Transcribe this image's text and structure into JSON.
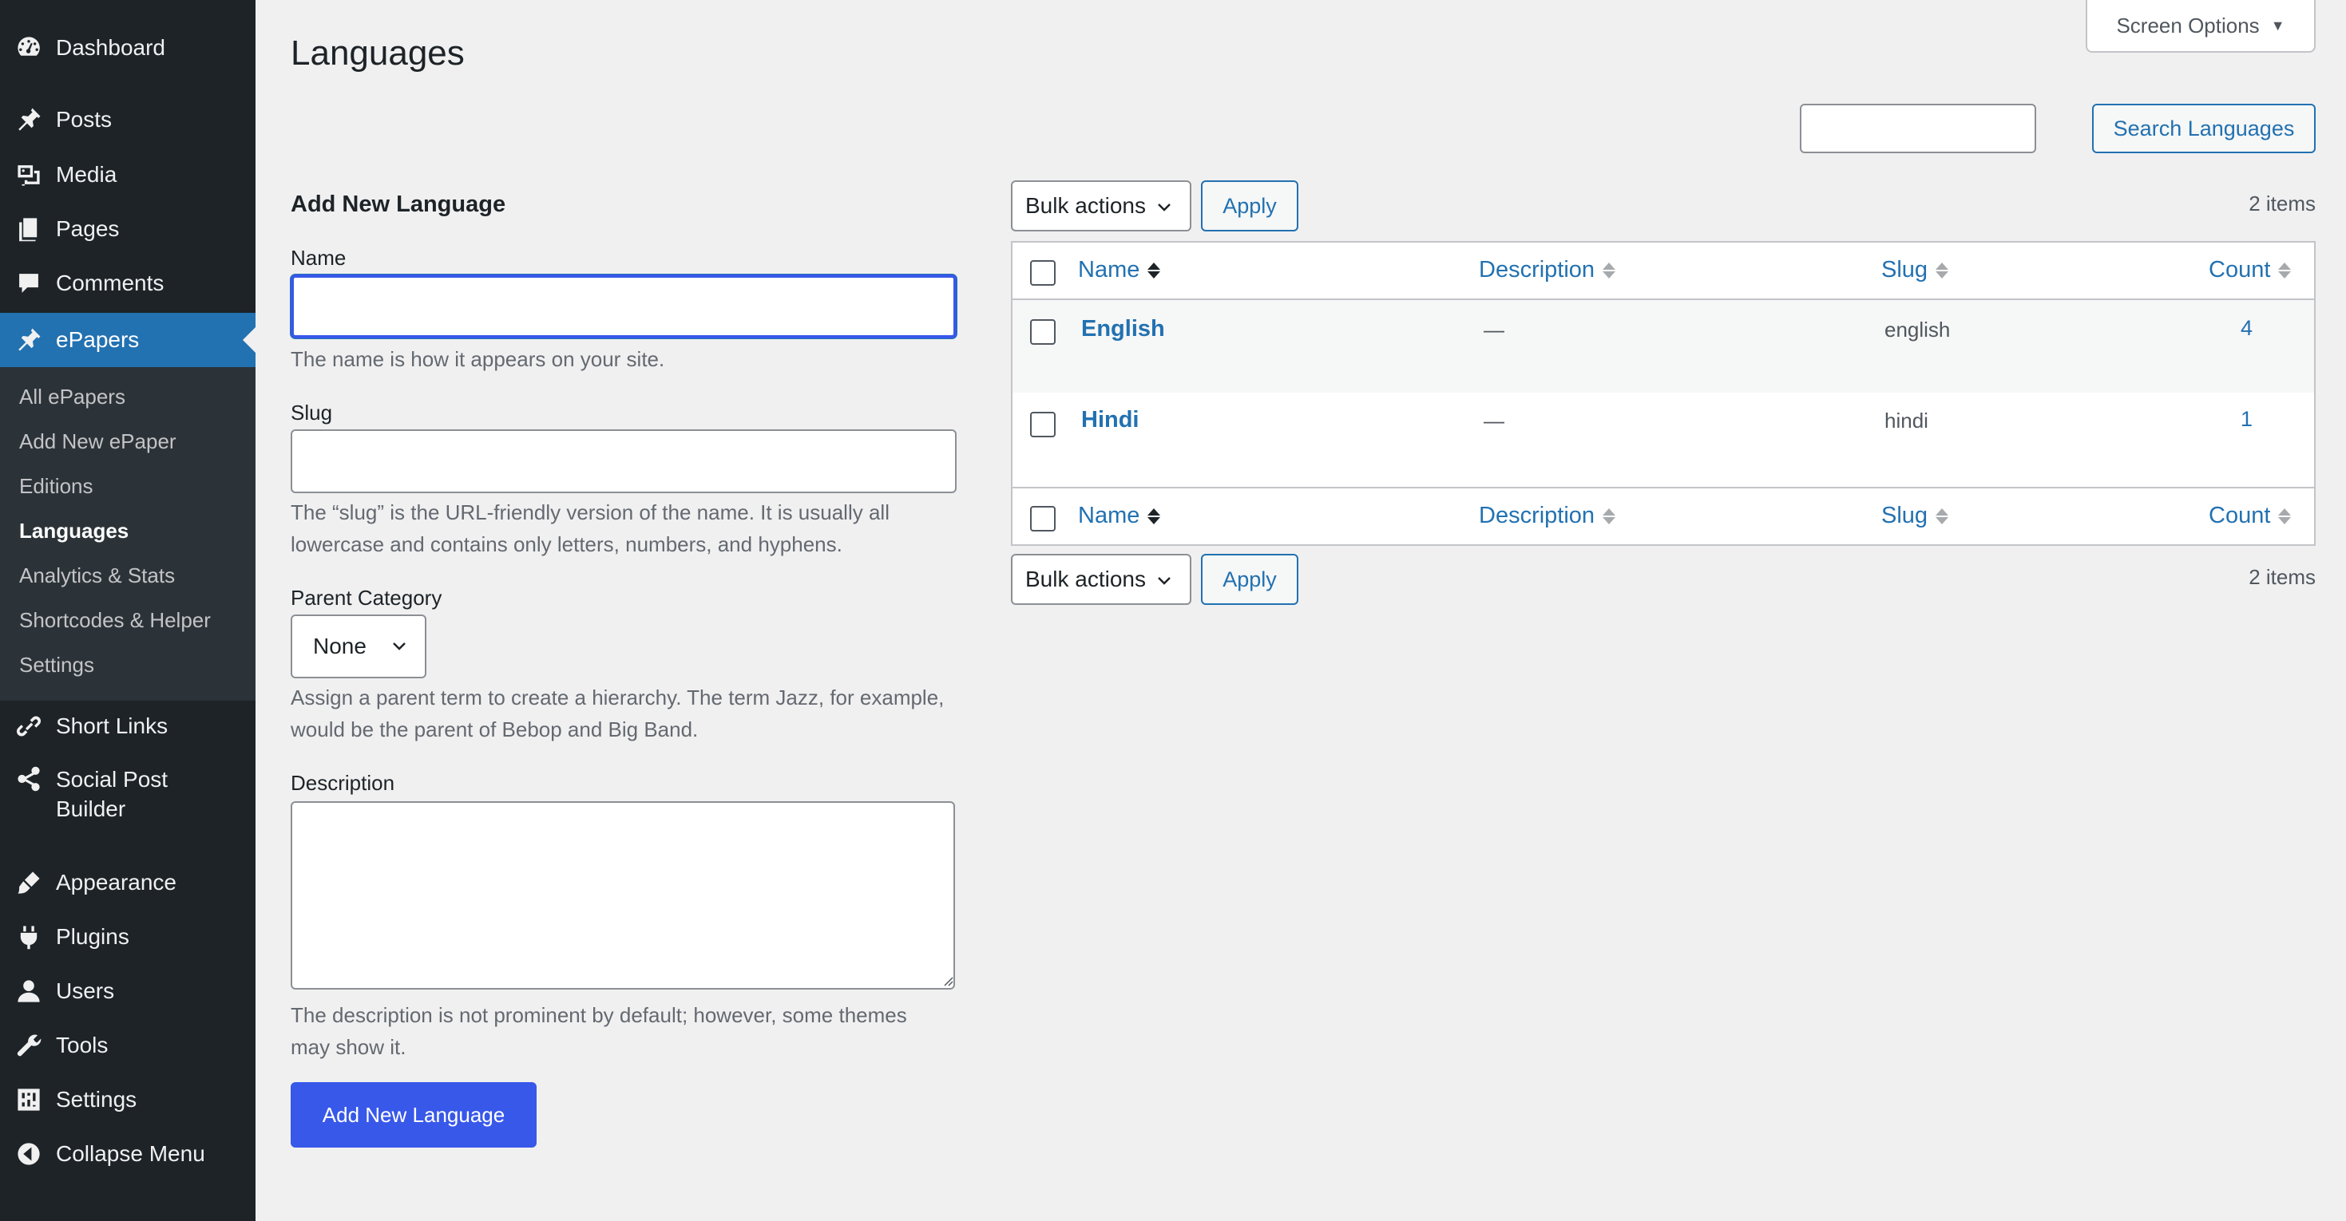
{
  "sidebar": {
    "menu": [
      {
        "label": "Dashboard",
        "icon": "dashboard-icon"
      },
      {
        "label": "Posts",
        "icon": "pin-icon"
      },
      {
        "label": "Media",
        "icon": "media-icon"
      },
      {
        "label": "Pages",
        "icon": "pages-icon"
      },
      {
        "label": "Comments",
        "icon": "comment-icon"
      },
      {
        "label": "ePapers",
        "icon": "pin-icon"
      },
      {
        "label": "Short Links",
        "icon": "link-icon"
      },
      {
        "label": "Social Post Builder",
        "icon": "share-icon"
      },
      {
        "label": "Appearance",
        "icon": "brush-icon"
      },
      {
        "label": "Plugins",
        "icon": "plugin-icon"
      },
      {
        "label": "Users",
        "icon": "user-icon"
      },
      {
        "label": "Tools",
        "icon": "wrench-icon"
      },
      {
        "label": "Settings",
        "icon": "settings-icon"
      },
      {
        "label": "Collapse Menu",
        "icon": "collapse-icon"
      }
    ],
    "submenu": [
      {
        "label": "All ePapers"
      },
      {
        "label": "Add New ePaper"
      },
      {
        "label": "Editions"
      },
      {
        "label": "Languages"
      },
      {
        "label": "Analytics & Stats"
      },
      {
        "label": "Shortcodes & Helper"
      },
      {
        "label": "Settings"
      }
    ]
  },
  "header": {
    "title": "Languages",
    "screen_options": "Screen Options",
    "search_value": "",
    "search_button": "Search Languages"
  },
  "form": {
    "heading": "Add New Language",
    "name_label": "Name",
    "name_value": "",
    "name_help": "The name is how it appears on your site.",
    "slug_label": "Slug",
    "slug_value": "",
    "slug_help": "The “slug” is the URL-friendly version of the name. It is usually all lowercase and contains only letters, numbers, and hyphens.",
    "parent_label": "Parent Category",
    "parent_value": "None",
    "parent_help": "Assign a parent term to create a hierarchy. The term Jazz, for example, would be the parent of Bebop and Big Band.",
    "description_label": "Description",
    "description_help": "The description is not prominent by default; however, some themes may show it.",
    "submit_label": "Add New Language"
  },
  "table": {
    "bulk_actions": "Bulk actions",
    "apply": "Apply",
    "items_count": "2 items",
    "columns": {
      "name": "Name",
      "description": "Description",
      "slug": "Slug",
      "count": "Count"
    },
    "rows": [
      {
        "name": "English",
        "description": "—",
        "slug": "english",
        "count": "4"
      },
      {
        "name": "Hindi",
        "description": "—",
        "slug": "hindi",
        "count": "1"
      }
    ]
  },
  "colors": {
    "sidebar_bg": "#1d2327",
    "accent": "#2271b1",
    "primary_button": "#3858e9"
  }
}
